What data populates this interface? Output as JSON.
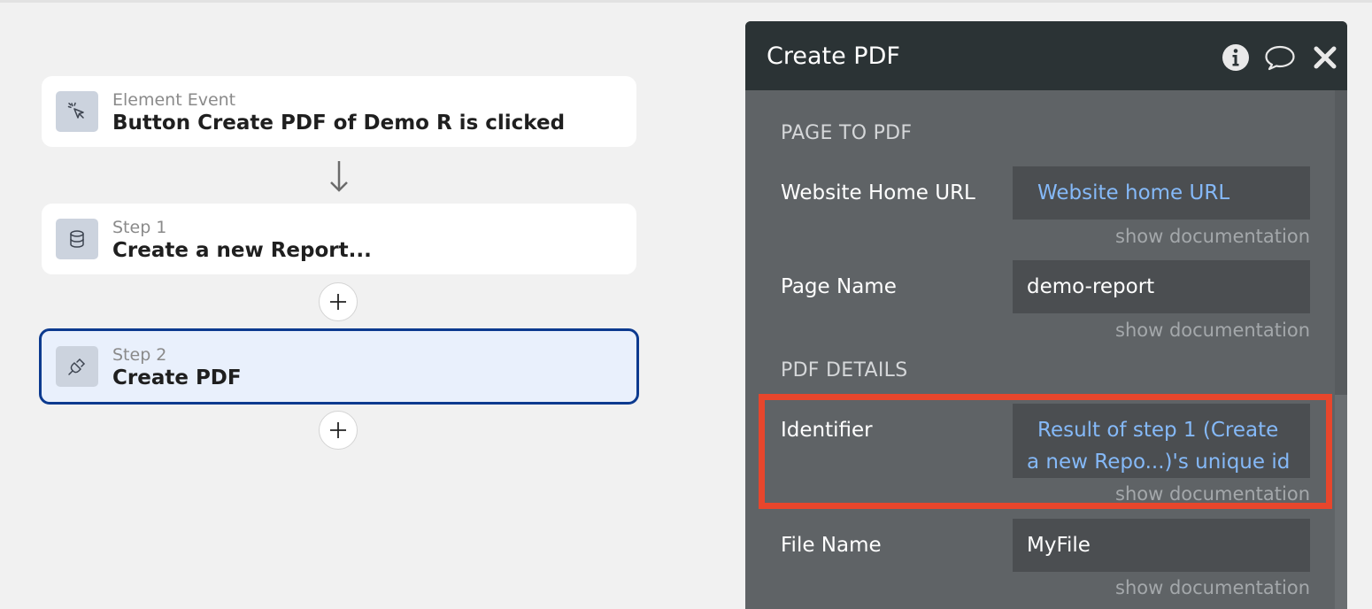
{
  "workflow": {
    "event": {
      "subtitle": "Element Event",
      "title": "Button Create PDF of Demo R is clicked",
      "icon": "cursor-click-icon"
    },
    "steps": [
      {
        "subtitle": "Step 1",
        "title": "Create a new Report...",
        "icon": "database-icon"
      },
      {
        "subtitle": "Step 2",
        "title": "Create PDF",
        "icon": "plug-icon",
        "selected": true
      }
    ]
  },
  "panel": {
    "title": "Create PDF",
    "header_icons": [
      "info-icon",
      "comment-icon",
      "close-icon"
    ],
    "sections": {
      "page_to_pdf": "PAGE TO PDF",
      "pdf_details": "PDF DETAILS"
    },
    "fields": {
      "website_home_url": {
        "label": "Website Home URL",
        "value": "Website home URL"
      },
      "page_name": {
        "label": "Page Name",
        "value": "demo-report"
      },
      "identifier": {
        "label": "Identifier",
        "value": "Result of step 1 (Create a new Repo...)'s unique id"
      },
      "file_name": {
        "label": "File Name",
        "value": "MyFile"
      }
    },
    "show_documentation": "show documentation"
  },
  "colors": {
    "selected_border": "#0c3a8f",
    "dynamic_value": "#85b9f8",
    "highlight": "#e8462c",
    "panel_bg": "#5f6366",
    "panel_header": "#2b3335"
  }
}
